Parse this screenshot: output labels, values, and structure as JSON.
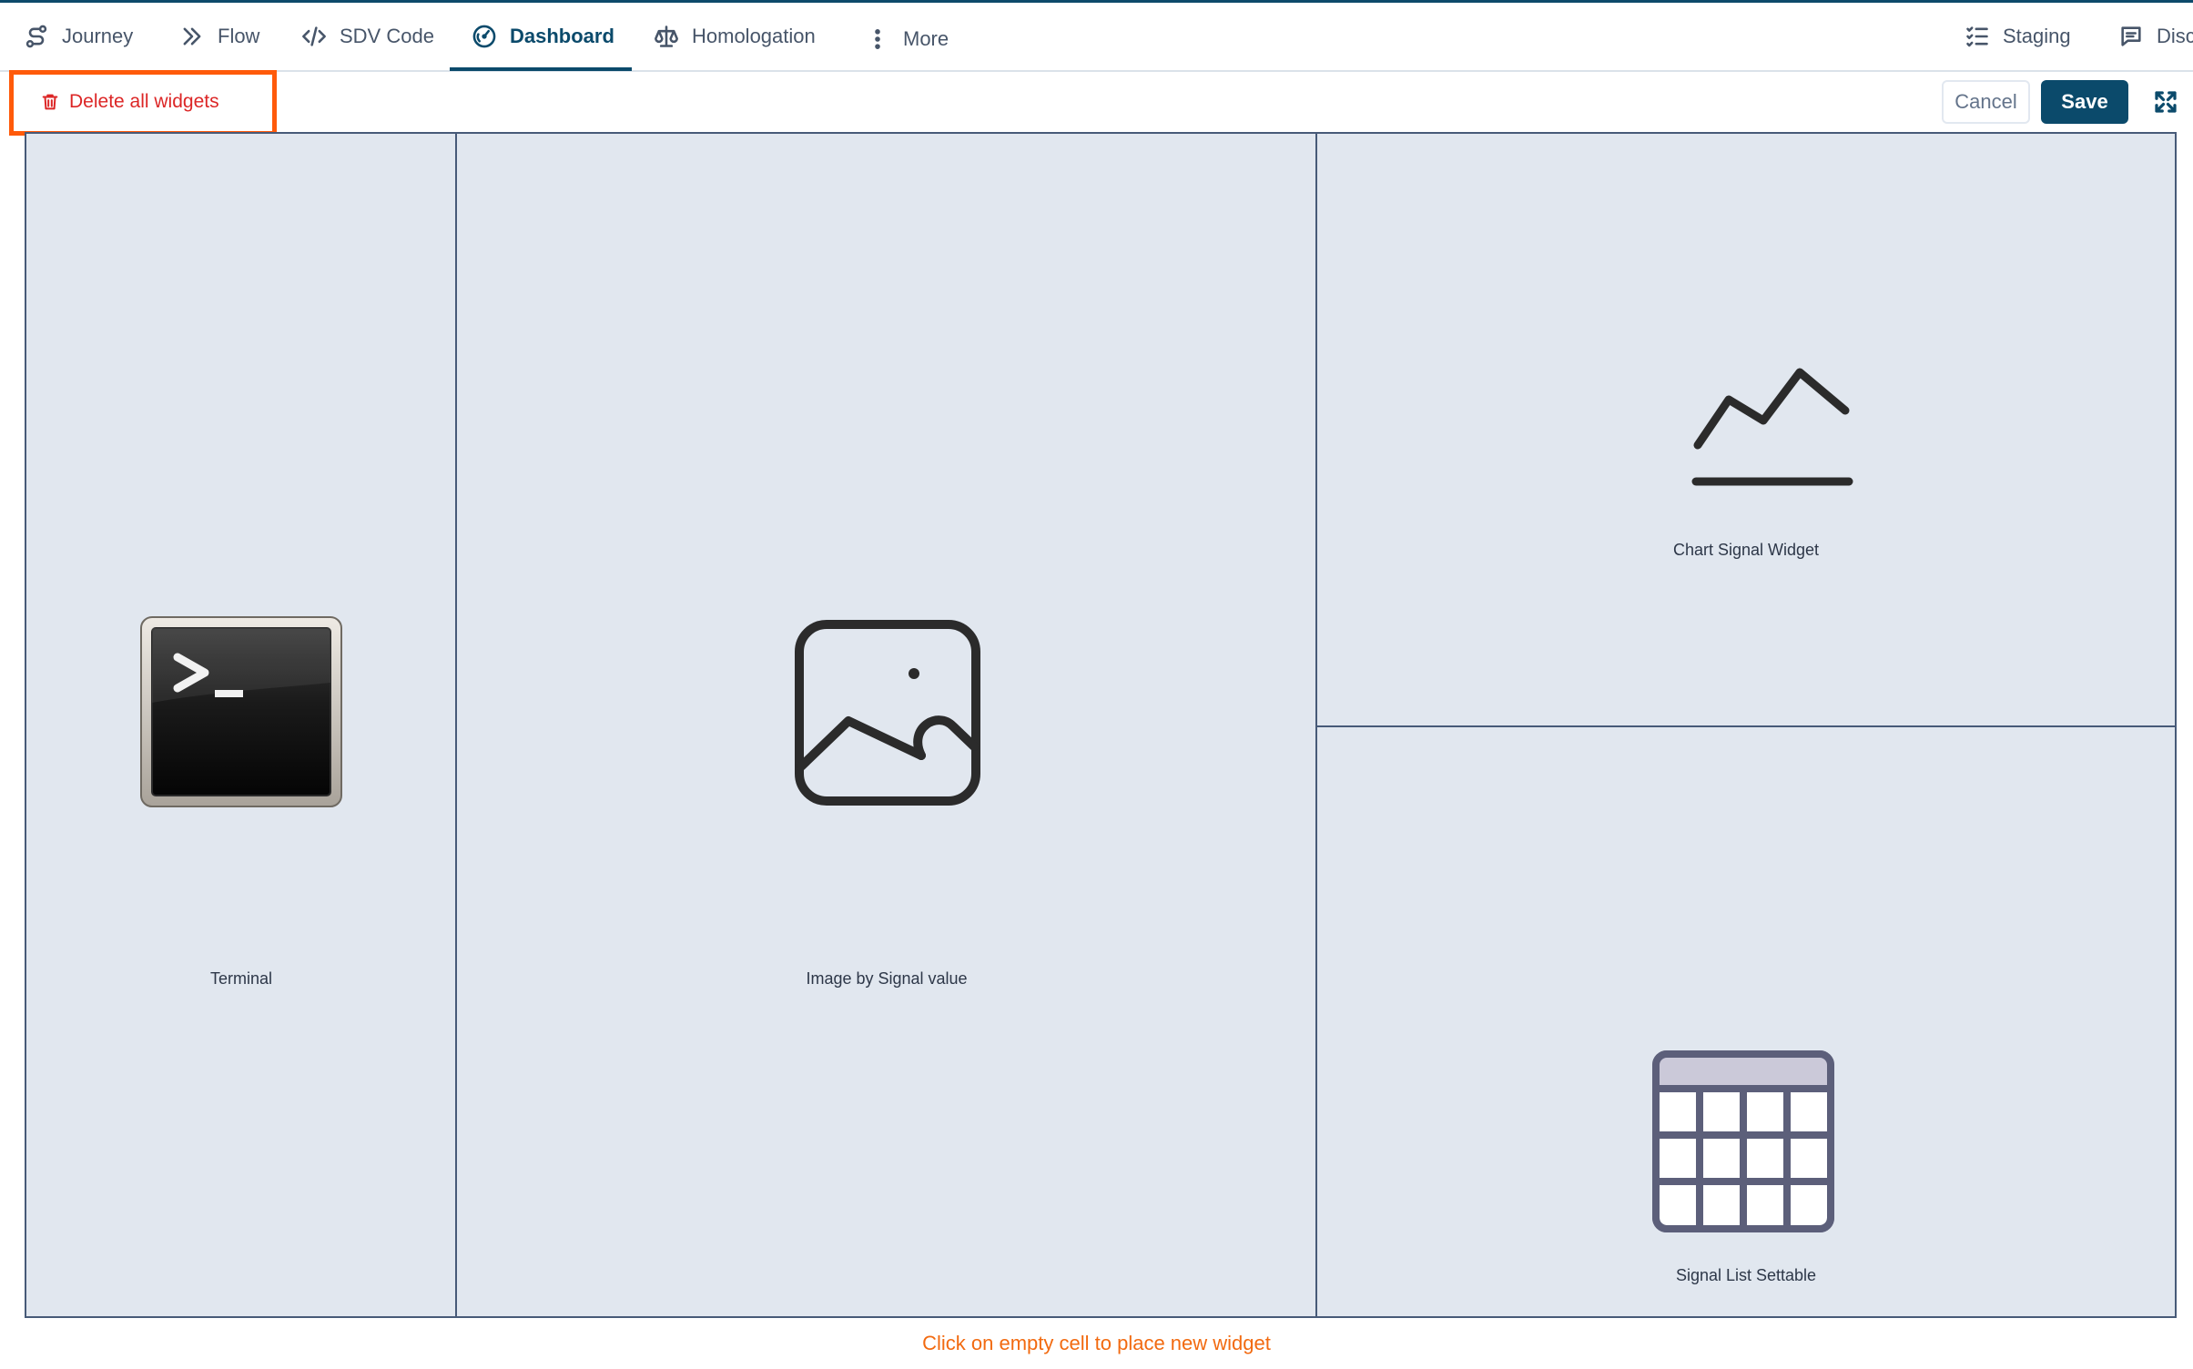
{
  "nav": {
    "tabs": [
      {
        "label": "Journey",
        "icon": "journey-icon"
      },
      {
        "label": "Flow",
        "icon": "double-chevron-right-icon"
      },
      {
        "label": "SDV Code",
        "icon": "code-icon"
      },
      {
        "label": "Dashboard",
        "icon": "gauge-icon",
        "active": true
      },
      {
        "label": "Homologation",
        "icon": "scale-icon"
      },
      {
        "label": "More",
        "icon": "vertical-dots-icon"
      }
    ],
    "right": [
      {
        "label": "Staging",
        "icon": "checklist-icon"
      },
      {
        "label": "Disc",
        "icon": "message-icon"
      }
    ]
  },
  "toolbar": {
    "delete_label": "Delete all widgets",
    "cancel_label": "Cancel",
    "save_label": "Save",
    "expand_icon": "fullscreen-icon"
  },
  "widgets": [
    {
      "name": "Terminal",
      "icon": "terminal-icon"
    },
    {
      "name": "Image by Signal value",
      "icon": "image-icon"
    },
    {
      "name": "Chart Signal Widget",
      "icon": "line-chart-icon"
    },
    {
      "name": "Signal List Settable",
      "icon": "table-icon"
    }
  ],
  "hint": "Click on empty cell to place new widget",
  "colors": {
    "primary": "#0b4a6b",
    "danger": "#dc2626",
    "highlight": "#ff5a0a",
    "grid_background": "#e1e7ef",
    "hint": "#f26a10"
  }
}
